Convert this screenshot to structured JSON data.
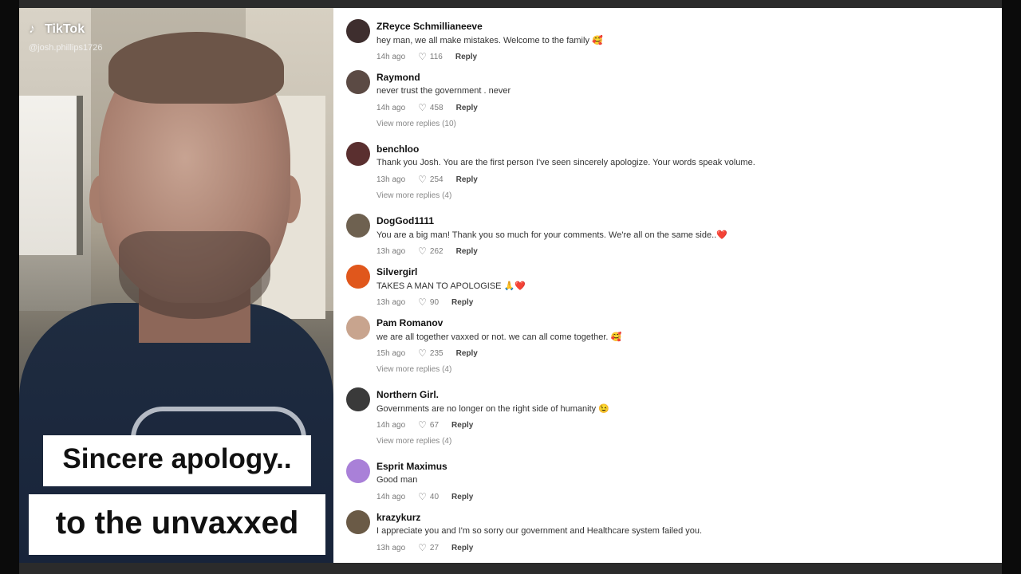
{
  "video": {
    "app_logo": "TikTok",
    "handle": "@josh.phillips1726",
    "caption_line1": "Sincere apology..",
    "caption_line2": "to the unvaxxed"
  },
  "comments": [
    {
      "name": "ZReyce Schmillianeeve",
      "text": "hey man, we all make mistakes. Welcome to the family",
      "emoji": "🥰",
      "time": "14h ago",
      "likes": "116",
      "reply": "Reply",
      "avatar_color": "#3e2e2e"
    },
    {
      "name": "Raymond",
      "text": "never trust the government . never",
      "emoji": "",
      "time": "14h ago",
      "likes": "458",
      "reply": "Reply",
      "avatar_color": "#5b4a44"
    },
    {
      "name": "benchloo",
      "text": "Thank you Josh. You are the first person I've seen sincerely apologize. Your words speak volume.",
      "emoji": "",
      "time": "13h ago",
      "likes": "254",
      "reply": "Reply",
      "avatar_color": "#5a2f2f"
    },
    {
      "name": "DogGod1111",
      "text": "You are a big man! Thank you so much for your comments. We're all on the same side..",
      "emoji": "❤️",
      "time": "13h ago",
      "likes": "262",
      "reply": "Reply",
      "avatar_color": "#6e6150"
    },
    {
      "name": "Silvergirl",
      "text": "TAKES A MAN TO APOLOGISE",
      "emoji": "🙏❤️",
      "time": "13h ago",
      "likes": "90",
      "reply": "Reply",
      "avatar_color": "#e0571c"
    },
    {
      "name": "Pam Romanov",
      "text": "we are all together vaxxed or not. we can all come together.",
      "emoji": "🥰",
      "time": "15h ago",
      "likes": "235",
      "reply": "Reply",
      "avatar_color": "#c8a48e"
    },
    {
      "name": "Northern Girl.",
      "text": "Governments are no longer on the right side of humanity",
      "emoji": "😉",
      "time": "14h ago",
      "likes": "67",
      "reply": "Reply",
      "avatar_color": "#3a3a3a"
    },
    {
      "name": "Esprit Maximus",
      "text": "Good man",
      "emoji": "",
      "time": "14h ago",
      "likes": "40",
      "reply": "Reply",
      "avatar_color": "#a980d8"
    },
    {
      "name": "krazykurz",
      "text": "I appreciate you and I'm so sorry our government and Healthcare system failed you.",
      "emoji": "",
      "time": "13h ago",
      "likes": "27",
      "reply": "Reply",
      "avatar_color": "#6a5a46"
    }
  ],
  "more_replies": [
    "View more replies (10)",
    "View more replies (4)",
    "View more replies (4)",
    "View more replies (4)"
  ]
}
